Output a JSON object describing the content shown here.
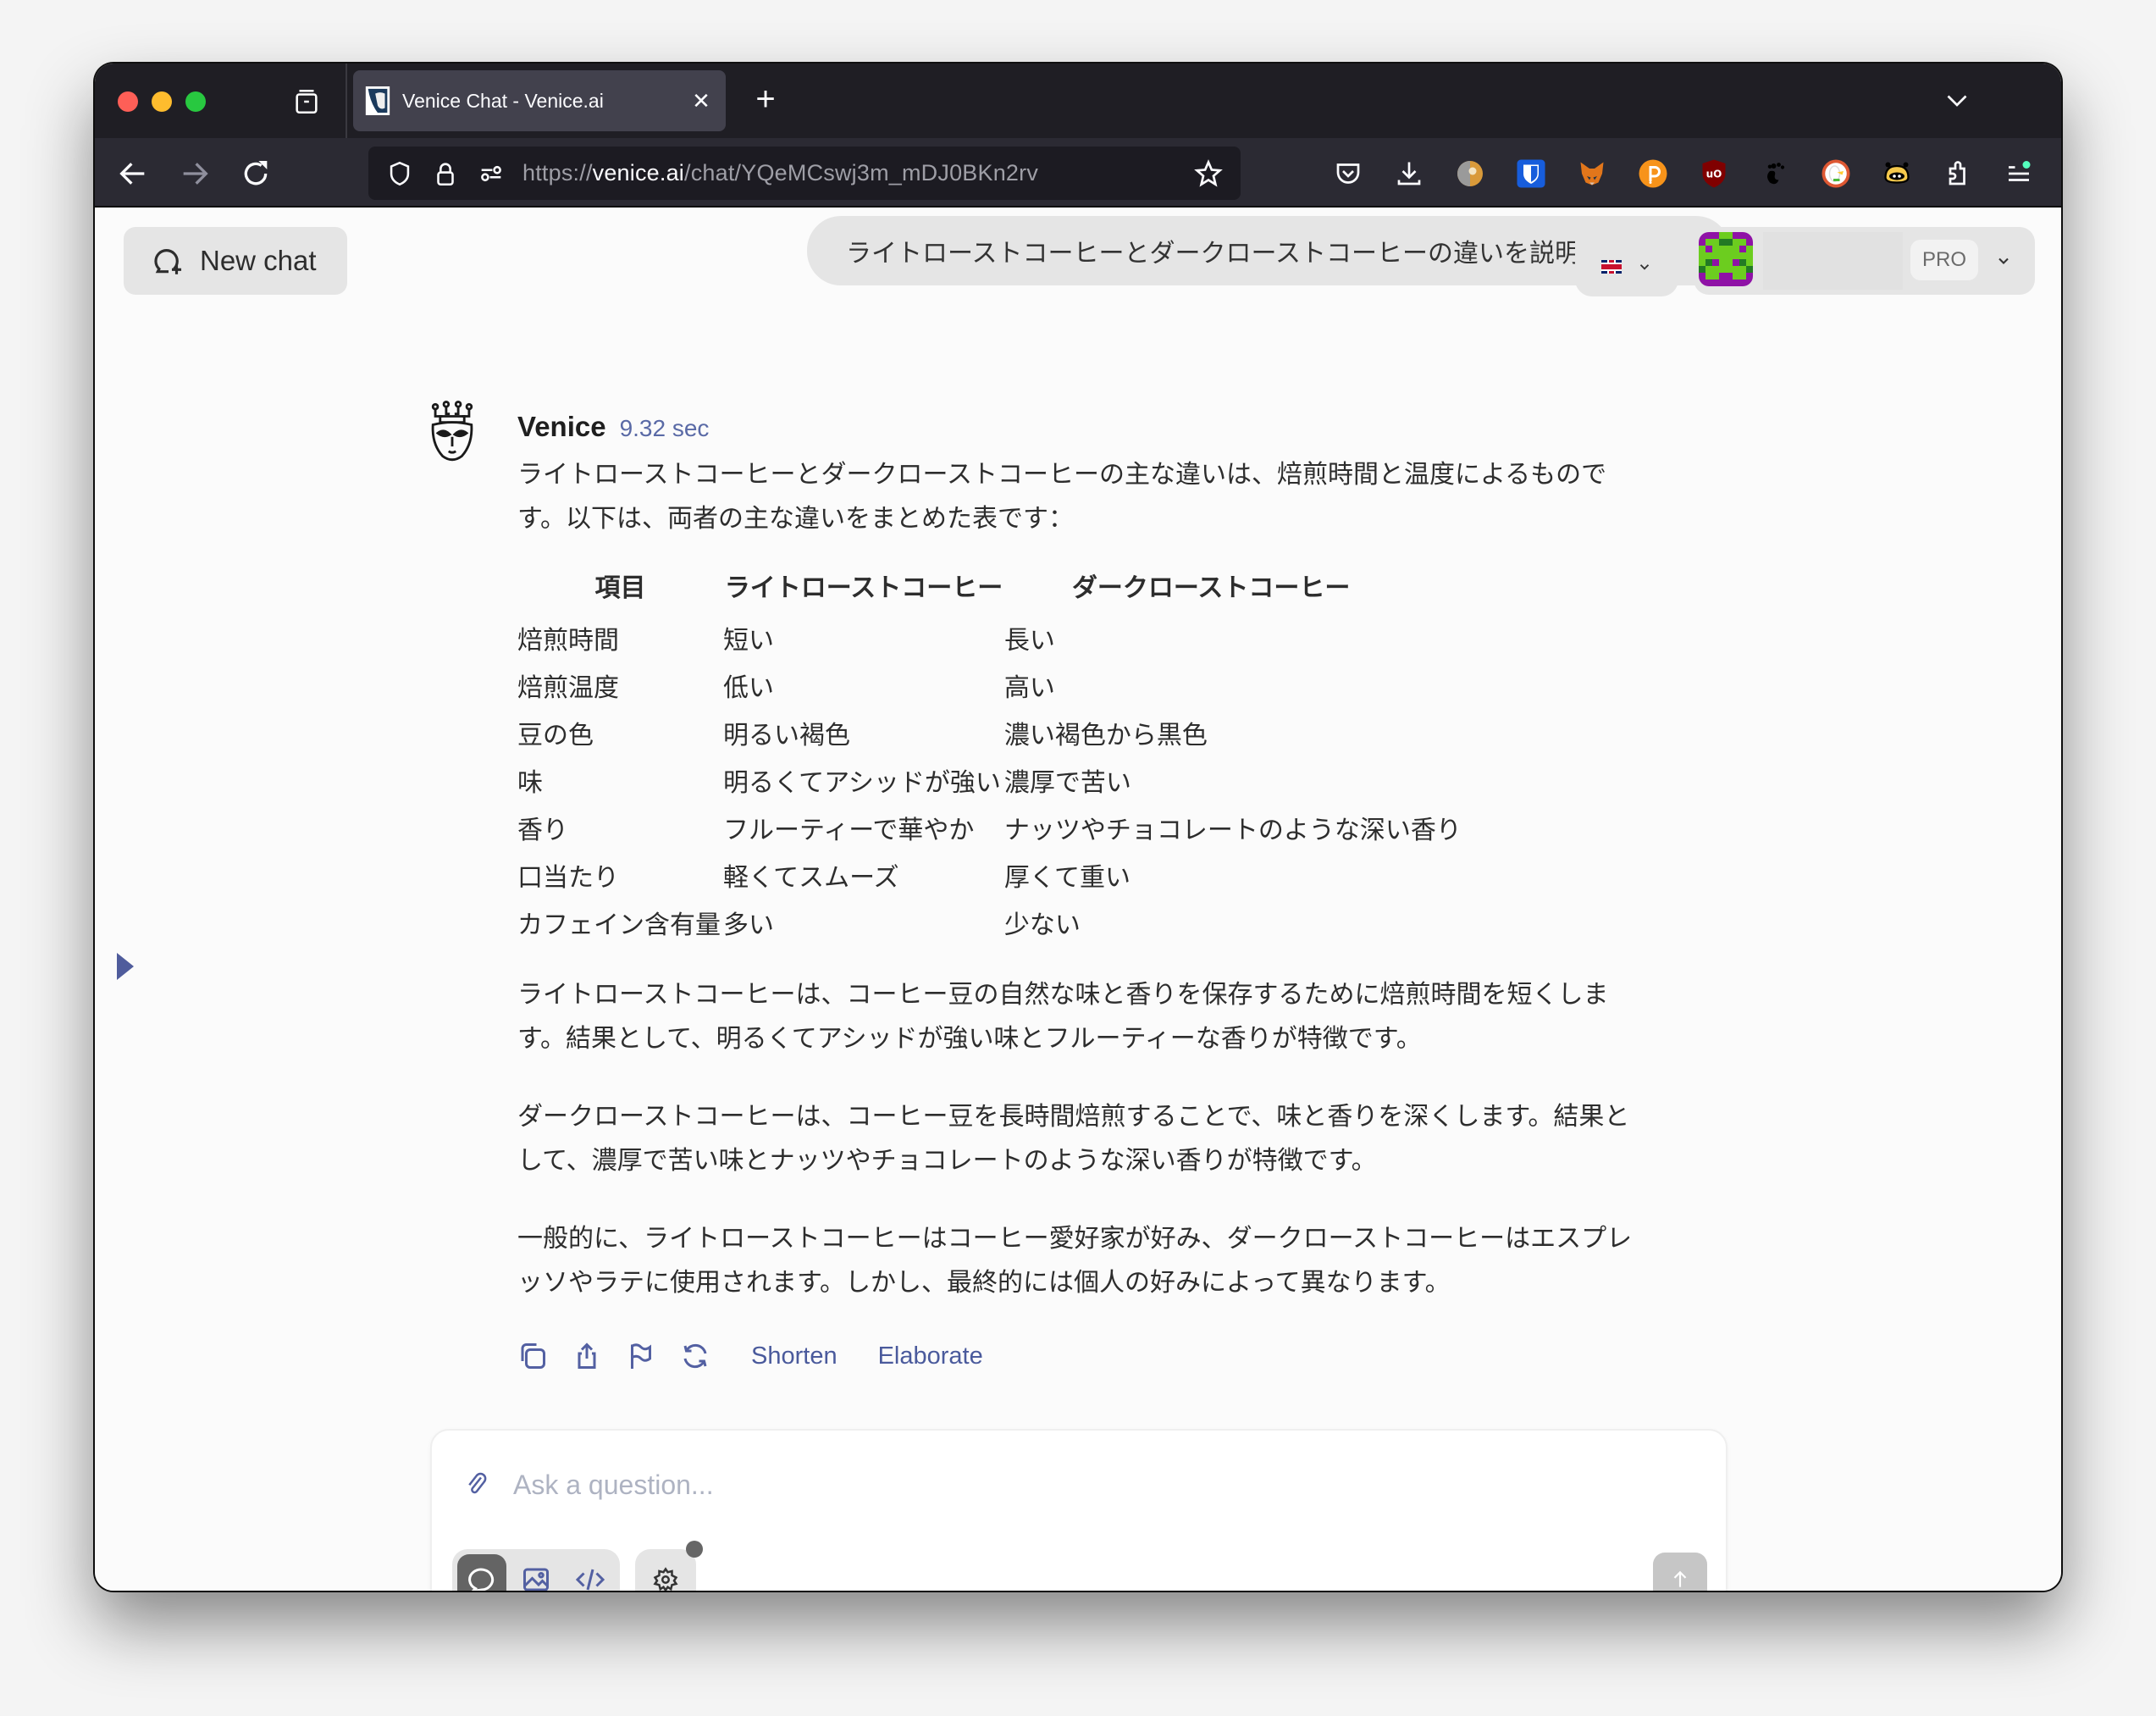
{
  "browser": {
    "tab": {
      "title": "Venice Chat - Venice.ai",
      "close_glyph": "✕"
    },
    "new_tab_glyph": "+",
    "url": {
      "scheme": "https://",
      "host": "venice.ai",
      "path": "/chat/YQeMCswj3m_mDJ0BKn2rv"
    },
    "extensions": [
      "pocket-icon",
      "downloads-icon",
      "extension-avatar-icon",
      "bitwarden-icon",
      "metamask-icon",
      "polkadot-icon",
      "ublock-origin-icon",
      "gnome-foot-icon",
      "duckduckgo-icon",
      "bee-extension-icon",
      "extensions-puzzle-icon",
      "app-menu-icon"
    ]
  },
  "header": {
    "new_chat_label": "New chat",
    "chat_title": "ライトローストコーヒーとダークローストコーヒーの違いを説明して",
    "language": "en-GB",
    "plan_badge": "PRO"
  },
  "message": {
    "author": "Venice",
    "elapsed": "9.32 sec",
    "intro": "ライトローストコーヒーとダークローストコーヒーの主な違いは、焙煎時間と温度によるものです。以下は、両者の主な違いをまとめた表です：",
    "table": {
      "headers": [
        "項目",
        "ライトローストコーヒー",
        "ダークローストコーヒー"
      ],
      "rows": [
        [
          "焙煎時間",
          "短い",
          "長い"
        ],
        [
          "焙煎温度",
          "低い",
          "高い"
        ],
        [
          "豆の色",
          "明るい褐色",
          "濃い褐色から黒色"
        ],
        [
          "味",
          "明るくてアシッドが強い",
          "濃厚で苦い"
        ],
        [
          "香り",
          "フルーティーで華やか",
          "ナッツやチョコレートのような深い香り"
        ],
        [
          "口当たり",
          "軽くてスムーズ",
          "厚くて重い"
        ],
        [
          "カフェイン含有量",
          "多い",
          "少ない"
        ]
      ]
    },
    "paragraphs": [
      "ライトローストコーヒーは、コーヒー豆の自然な味と香りを保存するために焙煎時間を短くします。結果として、明るくてアシッドが強い味とフルーティーな香りが特徴です。",
      "ダークローストコーヒーは、コーヒー豆を長時間焙煎することで、味と香りを深くします。結果として、濃厚で苦い味とナッツやチョコレートのような深い香りが特徴です。",
      "一般的に、ライトローストコーヒーはコーヒー愛好家が好み、ダークローストコーヒーはエスプレッソやラテに使用されます。しかし、最終的には個人の好みによって異なります。"
    ],
    "actions": {
      "shorten": "Shorten",
      "elaborate": "Elaborate"
    }
  },
  "composer": {
    "placeholder": "Ask a question...",
    "modes": [
      "chat",
      "image",
      "code"
    ],
    "active_mode": "chat"
  },
  "colors": {
    "accent": "#5360a2",
    "tabbar_bg": "#1f1e24",
    "toolbar_bg": "#2b2a33",
    "content_bg": "#fbfbfb"
  }
}
